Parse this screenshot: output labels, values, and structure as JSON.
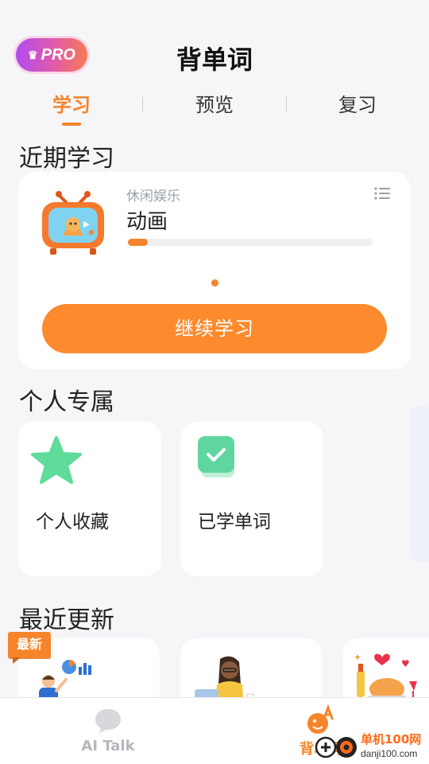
{
  "header": {
    "pro_label": "PRO",
    "title": "背单词"
  },
  "tabs": [
    {
      "label": "学习",
      "active": true
    },
    {
      "label": "预览",
      "active": false
    },
    {
      "label": "复习",
      "active": false
    }
  ],
  "recent": {
    "section_title": "近期学习",
    "category": "休闲娱乐",
    "book_title": "动画",
    "progress": 0.08,
    "continue_label": "继续学习"
  },
  "personal": {
    "section_title": "个人专属",
    "items": [
      {
        "label": "个人收藏",
        "icon": "star-icon"
      },
      {
        "label": "已学单词",
        "icon": "check-icon"
      }
    ]
  },
  "updates": {
    "section_title": "最近更新",
    "new_tag": "最新"
  },
  "bottom_nav": [
    {
      "label": "AI Talk",
      "icon": "chat-icon",
      "active": false
    },
    {
      "label": "背单词",
      "icon": "vocab-icon",
      "active": true
    }
  ],
  "watermark": {
    "text": "单机100网",
    "url": "danji100.com"
  },
  "colors": {
    "accent": "#f5842a",
    "button": "#fd8a2c",
    "star": "#5fdc9a",
    "check": "#5fd6a0"
  }
}
